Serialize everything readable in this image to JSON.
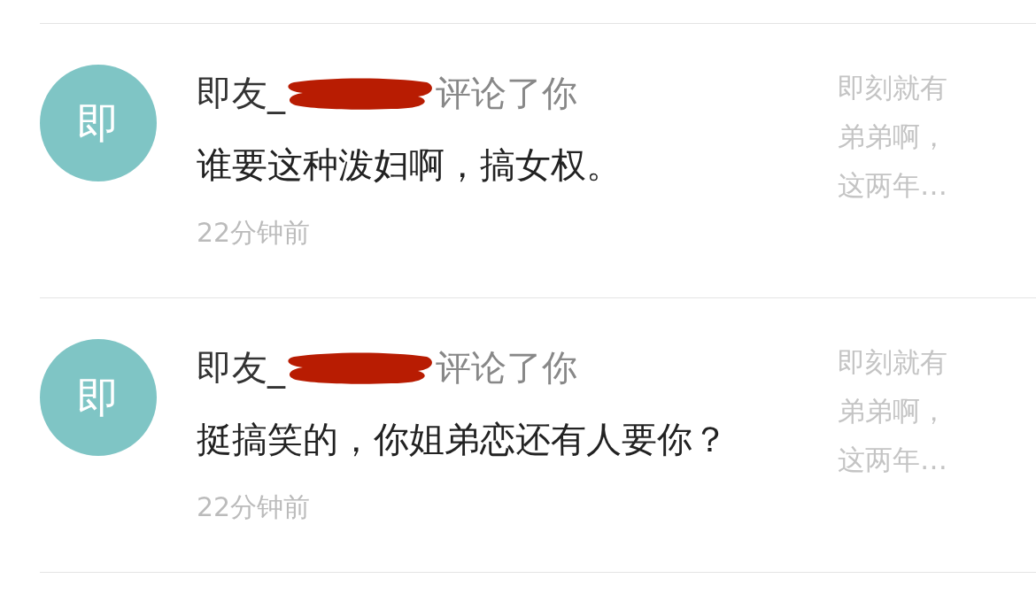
{
  "notifications": [
    {
      "avatar": "即",
      "name_prefix": "即友_",
      "action": "评论了你",
      "comment": "谁要这种泼妇啊，搞女权。",
      "time": "22分钟前",
      "preview": "即刻就有弟弟啊，这两年…"
    },
    {
      "avatar": "即",
      "name_prefix": "即友_",
      "action": "评论了你",
      "comment": "挺搞笑的，你姐弟恋还有人要你？",
      "time": "22分钟前",
      "preview": "即刻就有弟弟啊，这两年…"
    }
  ]
}
